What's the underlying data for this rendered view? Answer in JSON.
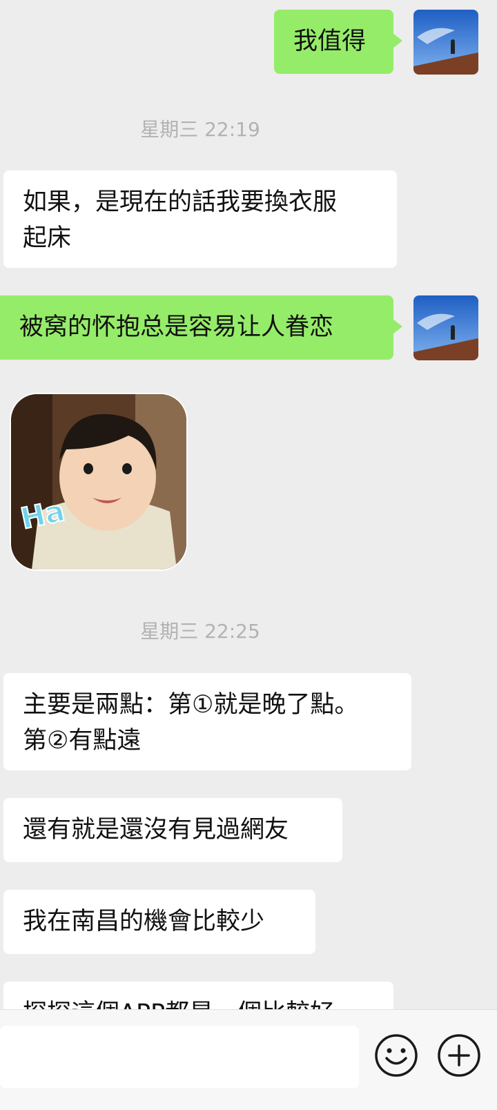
{
  "messages": {
    "m1": {
      "direction": "out",
      "text": "我值得"
    },
    "ts1": "星期三 22:19",
    "m2": {
      "direction": "in",
      "line1": "如果，是現在的話我要換衣服",
      "line2": "起床"
    },
    "m3": {
      "direction": "out",
      "text": "被窝的怀抱总是容易让人眷恋"
    },
    "m4": {
      "direction": "in",
      "type": "sticker",
      "sticker_text": "Ha"
    },
    "ts2": "星期三 22:25",
    "m5": {
      "direction": "in",
      "line1": "主要是兩點：第①就是晚了點。",
      "line2": "第②有點遠"
    },
    "m6": {
      "direction": "in",
      "text": "還有就是還沒有見過網友"
    },
    "m7": {
      "direction": "in",
      "text": "我在南昌的機會比較少"
    },
    "m8": {
      "direction": "in",
      "text": "探探這個APP都是一個比較好"
    }
  },
  "input_bar": {
    "text_value": "",
    "emoji_icon": "smiley-face-icon",
    "more_icon": "plus-circle-icon"
  },
  "colors": {
    "background": "#ededed",
    "incoming_bubble": "#ffffff",
    "outgoing_bubble": "#95ec69",
    "timestamp": "#b2b2b2"
  }
}
